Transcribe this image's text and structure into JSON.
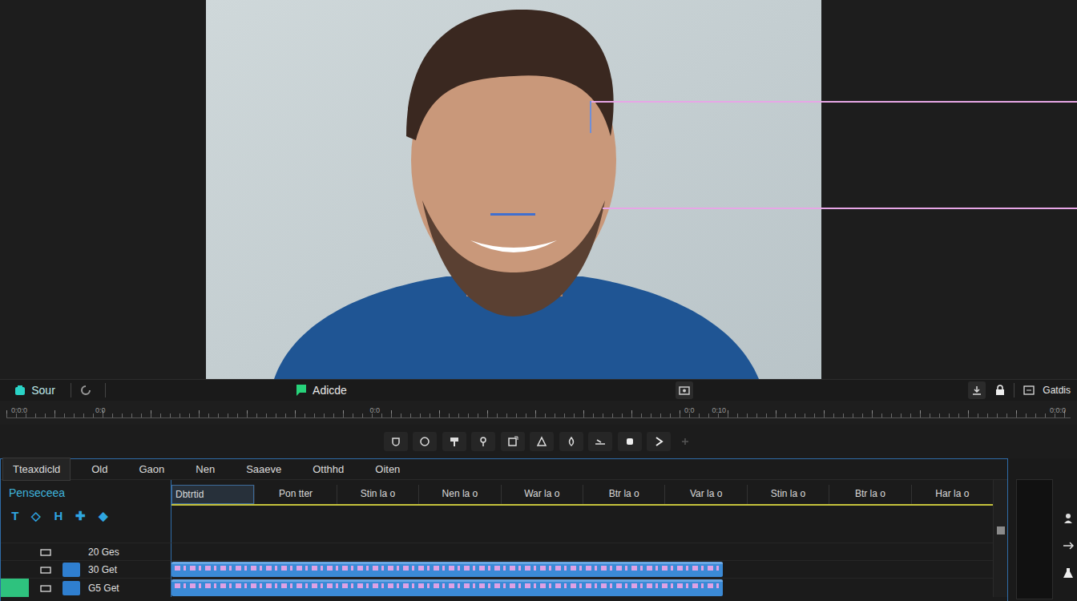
{
  "toolbar": {
    "source": "Sour",
    "center": "Adicde",
    "right": "Gatdis"
  },
  "ruler": {
    "labels": [
      "0:0:0",
      "0:0",
      "0:0",
      "0:0",
      "0:10",
      "0:0:0"
    ]
  },
  "panel": {
    "tabs": [
      {
        "label": "Tteaxdicld",
        "selected": true
      },
      {
        "label": "Old",
        "selected": false
      },
      {
        "label": "Gaon",
        "selected": false
      },
      {
        "label": "Nen",
        "selected": false
      },
      {
        "label": "Saaeve",
        "selected": false
      },
      {
        "label": "Otthhd",
        "selected": false
      },
      {
        "label": "Oiten",
        "selected": false
      }
    ],
    "title": "Penseceea",
    "tool_chars": [
      "T",
      "◇",
      "H",
      "✚",
      "◆"
    ],
    "columns": [
      {
        "label": "Dbtrtid",
        "selected": true
      },
      {
        "label": "Pon tter",
        "selected": false
      },
      {
        "label": "Stin la o",
        "selected": false
      },
      {
        "label": "Nen la o",
        "selected": false
      },
      {
        "label": "War la o",
        "selected": false
      },
      {
        "label": "Btr la o",
        "selected": false
      },
      {
        "label": "Var la o",
        "selected": false
      },
      {
        "label": "Stin la o",
        "selected": false
      },
      {
        "label": "Btr la o",
        "selected": false
      },
      {
        "label": "Har la o",
        "selected": false
      }
    ],
    "tracks": [
      {
        "label": "20 Ges",
        "kind": "empty",
        "selected": false
      },
      {
        "label": "30 Get",
        "kind": "clip",
        "selected": false
      },
      {
        "label": "G5 Get",
        "kind": "clip",
        "selected": true
      }
    ]
  }
}
